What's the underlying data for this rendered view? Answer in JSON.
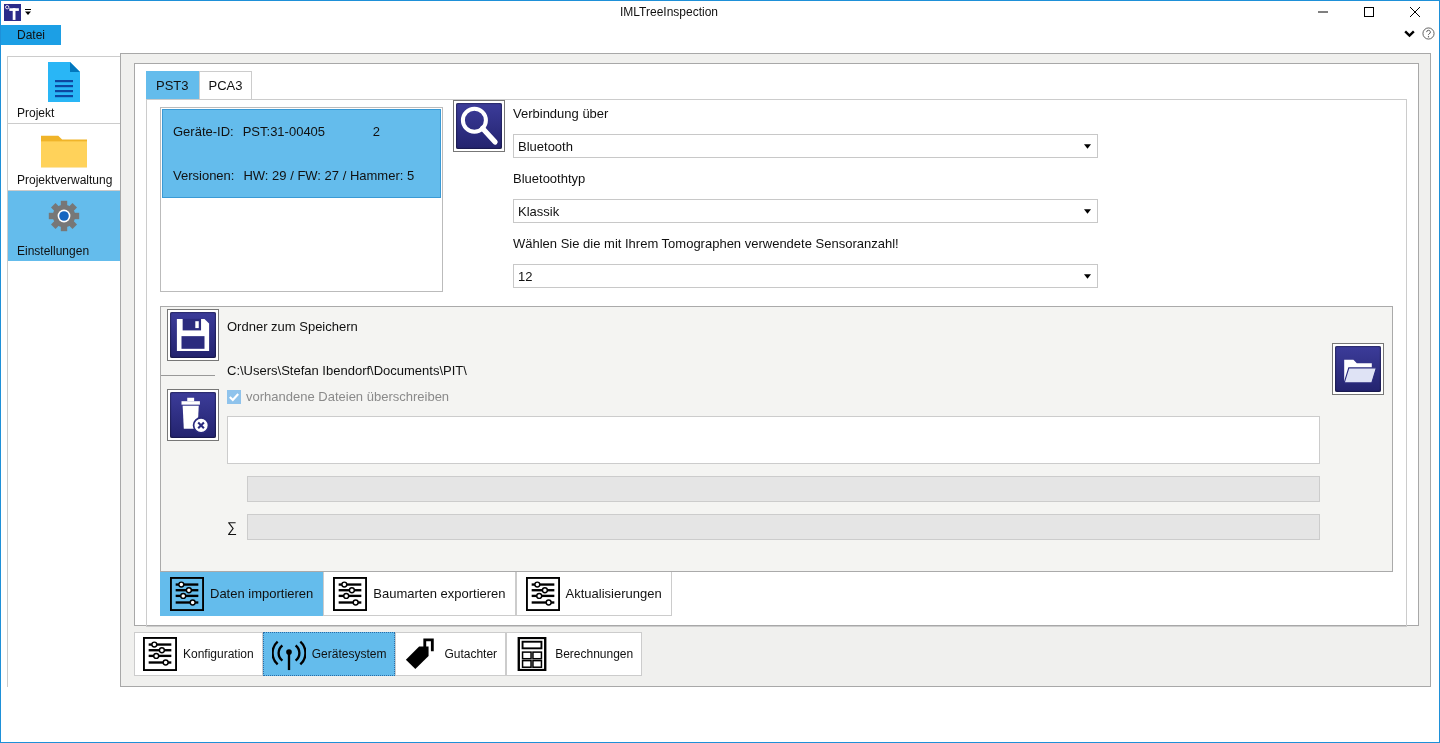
{
  "window": {
    "title": "IMLTreeInspection"
  },
  "menu": [
    {
      "label": "Datei",
      "selected": true
    }
  ],
  "sidebar": {
    "items": [
      {
        "label": "Projekt",
        "kind": "document",
        "selected": false
      },
      {
        "label": "Projektverwaltung",
        "kind": "folder",
        "selected": false
      },
      {
        "label": "Einstellungen",
        "kind": "gear",
        "selected": true
      }
    ]
  },
  "device_tabs": [
    {
      "label": "PST3",
      "selected": true
    },
    {
      "label": "PCA3",
      "selected": false
    }
  ],
  "device_info": {
    "id_label": "Geräte-ID:",
    "id_value": "PST:31-00405",
    "count": "2",
    "versions_label": "Versionen:",
    "versions_value": "HW: 29 / FW: 27 / Hammer: 5"
  },
  "connection": [
    {
      "label": "Verbindung über",
      "value": "Bluetooth"
    },
    {
      "label": "Bluetoothtyp",
      "value": "Klassik"
    },
    {
      "label": "Wählen Sie die mit Ihrem Tomographen verwendete Sensoranzahl!",
      "value": "12"
    }
  ],
  "storage": {
    "title": "Ordner zum Speichern",
    "path": "C:\\Users\\Stefan Ibendorf\\Documents\\PIT\\",
    "overwrite": {
      "label": "vorhandene Dateien überschreiben",
      "checked": true,
      "disabled": true
    },
    "sum_symbol": "∑",
    "progress": {
      "level": 0
    },
    "total_progress": {
      "level": 0
    }
  },
  "action_tabs": [
    {
      "label": "Daten importieren",
      "selected": true
    },
    {
      "label": "Baumarten exportieren",
      "selected": false
    },
    {
      "label": "Aktualisierungen",
      "selected": false
    }
  ],
  "bottom_tabs": [
    {
      "label": "Konfiguration",
      "kind": "sliders",
      "selected": false
    },
    {
      "label": "Gerätesystem",
      "kind": "antenna",
      "selected": true
    },
    {
      "label": "Gutachter",
      "kind": "tag",
      "selected": false
    },
    {
      "label": "Berechnungen",
      "kind": "calculator",
      "selected": false
    }
  ]
}
